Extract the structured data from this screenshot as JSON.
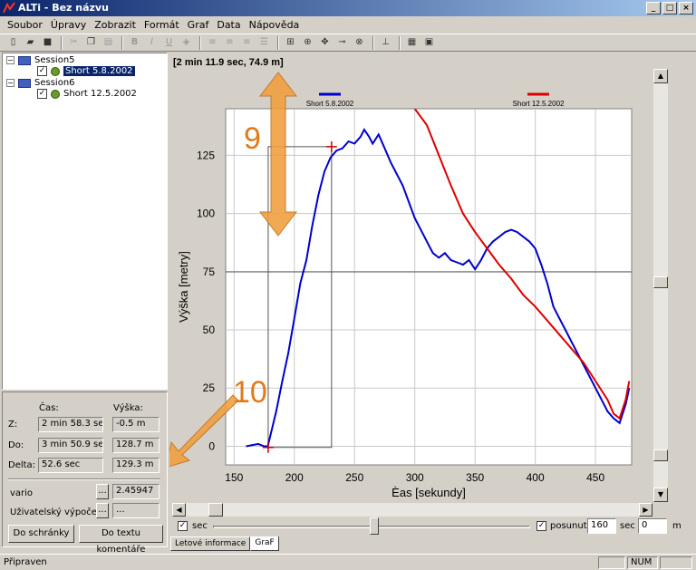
{
  "window": {
    "title": "ALTi - Bez názvu",
    "minimize": "_",
    "maximize": "□",
    "close": "×"
  },
  "menu": [
    "Soubor",
    "Úpravy",
    "Zobrazit",
    "Formát",
    "Graf",
    "Data",
    "Nápověda"
  ],
  "tree": {
    "sessions": [
      {
        "name": "Session5",
        "flight": "Short 5.8.2002"
      },
      {
        "name": "Session6",
        "flight": "Short 12.5.2002"
      }
    ]
  },
  "stats": {
    "col_time": "Čas:",
    "col_height": "Výška:",
    "rows": [
      {
        "label": "Z:",
        "time": "2 min 58.3 sec",
        "height": "-0.5 m"
      },
      {
        "label": "Do:",
        "time": "3 min 50.9 sec",
        "height": "128.7 m"
      },
      {
        "label": "Delta:",
        "time": "52.6 sec",
        "height": "129.3 m"
      }
    ],
    "vario_label": "vario",
    "vario_button": "...",
    "vario_value": "2.45947",
    "user_calc_label": "Uživatelský výpočet",
    "user_calc_button": "...",
    "user_calc_value": "...",
    "copy_button": "Do schránky",
    "comment_button": "Do textu komentáře"
  },
  "graph": {
    "cursor_readout": "[2 min 11.9 sec, 74.9 m]",
    "annotation_9": "9",
    "annotation_10": "10"
  },
  "chart_data": {
    "type": "line",
    "xlabel": "Èas [sekundy]",
    "ylabel": "Výška [metry]",
    "xlim": [
      143,
      480
    ],
    "ylim": [
      -8,
      145
    ],
    "xticks": [
      150,
      200,
      250,
      300,
      350,
      400,
      450
    ],
    "yticks": [
      0,
      25,
      50,
      75,
      100,
      125
    ],
    "grid": true,
    "legend_position": "top",
    "series": [
      {
        "name": "Short 5.8.2002",
        "color": "#0000cc",
        "x": [
          160,
          170,
          175,
          178,
          185,
          190,
          195,
          200,
          205,
          210,
          215,
          220,
          225,
          230,
          235,
          240,
          245,
          250,
          255,
          258,
          262,
          265,
          270,
          275,
          280,
          290,
          300,
          310,
          315,
          320,
          325,
          330,
          335,
          340,
          345,
          350,
          355,
          360,
          365,
          370,
          375,
          380,
          385,
          390,
          395,
          400,
          405,
          410,
          415,
          420,
          425,
          430,
          435,
          440,
          445,
          450,
          455,
          460,
          465,
          470,
          475,
          478
        ],
        "y": [
          0,
          1,
          0,
          0,
          15,
          28,
          40,
          55,
          70,
          80,
          95,
          108,
          118,
          124,
          127,
          128,
          131,
          130,
          133,
          136,
          133,
          130,
          134,
          128,
          122,
          112,
          98,
          88,
          83,
          81,
          83,
          80,
          79,
          78,
          80,
          76,
          80,
          85,
          88,
          90,
          92,
          93,
          92,
          90,
          88,
          85,
          78,
          70,
          60,
          55,
          50,
          45,
          40,
          35,
          30,
          25,
          20,
          15,
          12,
          10,
          18,
          25
        ]
      },
      {
        "name": "Short 12.5.2002",
        "color": "#dd0000",
        "x": [
          300,
          310,
          320,
          330,
          340,
          350,
          360,
          370,
          380,
          390,
          400,
          410,
          420,
          430,
          440,
          450,
          460,
          465,
          470,
          475,
          478
        ],
        "y": [
          145,
          138,
          125,
          112,
          100,
          92,
          85,
          78,
          72,
          65,
          60,
          54,
          48,
          42,
          36,
          28,
          20,
          14,
          12,
          20,
          28
        ]
      }
    ],
    "cursor_marks": [
      {
        "x": 178.3,
        "y": -0.5
      },
      {
        "x": 230.9,
        "y": 128.7
      }
    ]
  },
  "scroll": {
    "sec_label": "sec",
    "posunuti_label": "posunutí:",
    "posunuti_value": "160",
    "sec_unit": "sec",
    "meters_value": "0",
    "meters_unit": "m"
  },
  "tabs": [
    "Letové informace",
    "GraF"
  ],
  "status": {
    "left": "Připraven",
    "num": "NUM"
  }
}
